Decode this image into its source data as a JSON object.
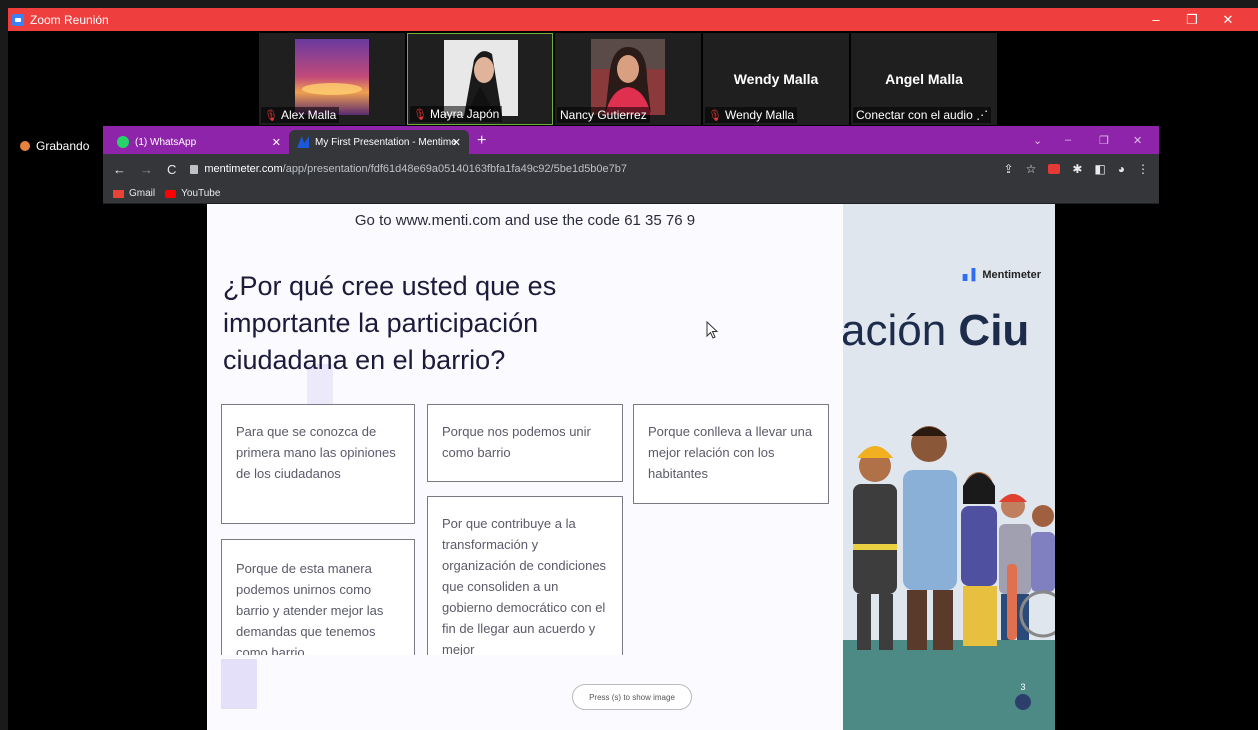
{
  "zoom": {
    "title": "Zoom Reunión",
    "controls": [
      "–",
      "❐",
      "✕"
    ],
    "recording_label": "Grabando",
    "participants": [
      {
        "name": "Alex Malla",
        "muted": true,
        "type": "image"
      },
      {
        "name": "Mayra Japón",
        "muted": true,
        "type": "video",
        "active": true
      },
      {
        "name": "Nancy Gutierrez",
        "muted": false,
        "type": "video"
      },
      {
        "name": "Wendy Malla",
        "muted": true,
        "type": "name",
        "big_name": "Wendy Malla"
      },
      {
        "name": "Conectar con el audio ⋰",
        "muted": false,
        "type": "name",
        "big_name": "Angel Malla"
      }
    ]
  },
  "browser": {
    "tabs": [
      {
        "label": "(1) WhatsApp",
        "icon": "whatsapp-icon"
      },
      {
        "label": "My First Presentation - Mentime",
        "icon": "mentimeter-icon",
        "active": true
      }
    ],
    "new_tab": "+",
    "url_host": "mentimeter.com",
    "url_path": "/app/presentation/fdf61d48e69a05140163fbfa1fa49c92/5be1d5b0e7b7",
    "bookmarks": [
      {
        "label": "Gmail",
        "icon": "gmail-icon"
      },
      {
        "label": "YouTube",
        "icon": "youtube-icon"
      }
    ]
  },
  "slide": {
    "code_text": "Go to www.menti.com and use the code 61 35 76 9",
    "question": "¿Por qué cree usted que es importante la participación ciudadana en el barrio?",
    "responses": [
      "Para que se conozca de primera mano las opiniones de los ciudadanos",
      "Porque nos podemos unir como barrio",
      "Porque conlleva a llevar una mejor relación con los habitantes",
      "Porque de esta manera podemos unirnos como barrio y atender mejor las demandas que tenemos como barrio",
      "Por que contribuye a la transformación y organización de condiciones que consoliden a un gobierno democrático con el fin de llegar aun acuerdo y mejor"
    ],
    "show_image_hint": "Press (s) to show image",
    "side_brand": "Mentimeter",
    "side_text_light": "ación ",
    "side_text_bold": "Ciu",
    "participant_count": "3"
  }
}
